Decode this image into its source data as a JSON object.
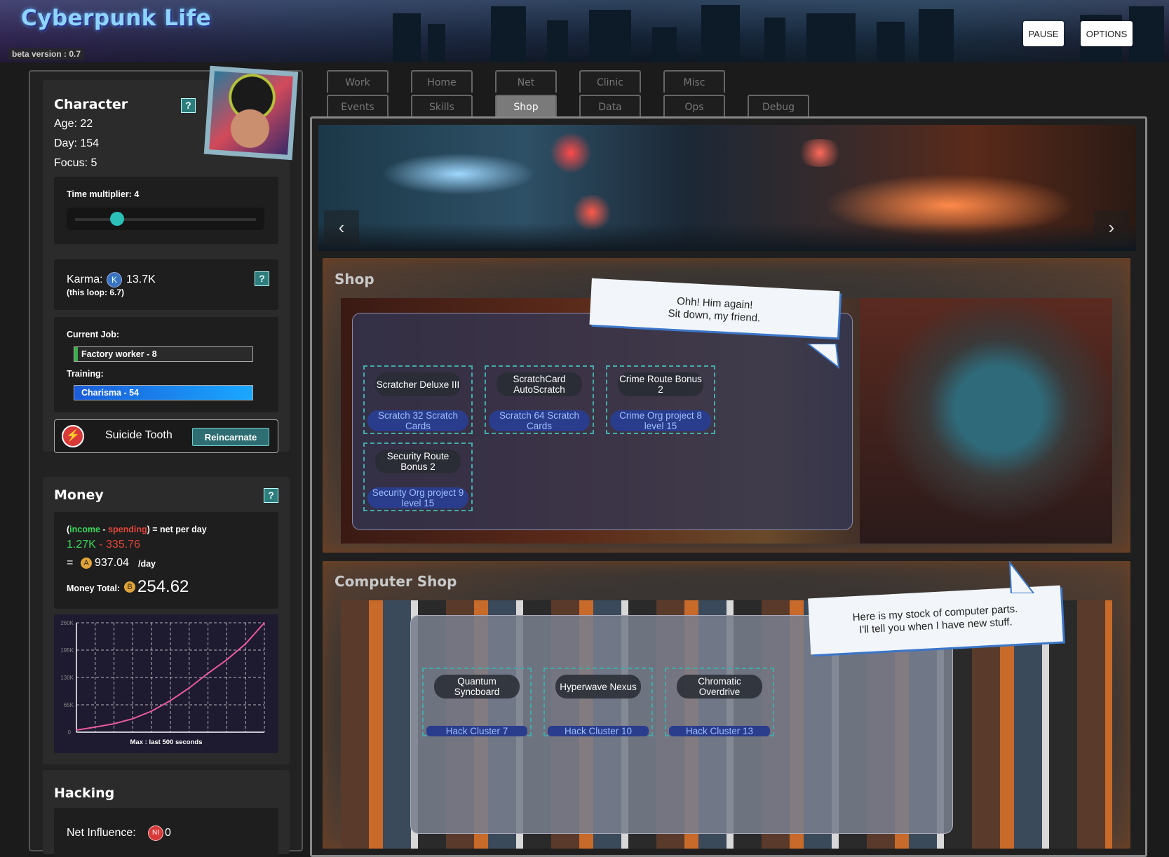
{
  "app": {
    "title": "Cyberpunk Life",
    "version": "beta version : 0.7",
    "pause_label": "PAUSE",
    "options_label": "OPTIONS"
  },
  "character": {
    "title": "Character",
    "help": "?",
    "age": "Age: 22",
    "day": "Day: 154",
    "focus": "Focus: 5",
    "time_multiplier_label": "Time multiplier: 4",
    "time_multiplier_value": 4,
    "karma_label": "Karma:",
    "karma_icon": "K",
    "karma_value": "13.7K",
    "karma_loop": "(this loop: 6.7)",
    "current_job_label": "Current Job:",
    "job": "Factory worker - 8",
    "job_progress": 0.02,
    "training_label": "Training:",
    "training": "Charisma - 54",
    "training_progress": 1.0,
    "suicide_label": "Suicide Tooth",
    "reincarnate_label": "Reincarnate"
  },
  "money": {
    "title": "Money",
    "help": "?",
    "formula_open": "(",
    "formula_income": "income",
    "formula_minus": " - ",
    "formula_spending": "spending",
    "formula_rest": ") = net per day",
    "income": "1.27K",
    "separator": " - ",
    "spending": "335.76",
    "equals": "=",
    "currency_icon": "A",
    "net": "937.04",
    "per_day": "/day",
    "total_label": "Money Total:",
    "total_icon": "B",
    "total": "254.62",
    "chart_note": "Max : last 500 seconds"
  },
  "hacking": {
    "title": "Hacking",
    "influence_label": "Net Influence:",
    "influence_icon": "NI",
    "influence_value": "0"
  },
  "tabs": {
    "row1": [
      "Work",
      "Home",
      "Net",
      "Clinic",
      "Misc"
    ],
    "row2": [
      "Events",
      "Skills",
      "Shop",
      "Data",
      "Ops",
      "Debug"
    ],
    "active": "Shop"
  },
  "banner": {
    "prev": "‹",
    "next": "›"
  },
  "shop": {
    "title": "Shop",
    "bubble_line1": "Ohh! Him again!",
    "bubble_line2": "Sit down, my friend.",
    "items": [
      {
        "name": "Scratcher Deluxe III",
        "price": "Scratch 32 Scratch Cards"
      },
      {
        "name": "ScratchCard AutoScratch",
        "price": "Scratch 64 Scratch Cards"
      },
      {
        "name": "Crime Route Bonus 2",
        "price": "Crime Org project 8 level 15"
      },
      {
        "name": "Security Route Bonus 2",
        "price": "Security Org project 9 level 15"
      }
    ]
  },
  "computer_shop": {
    "title": "Computer Shop",
    "bubble_line1": "Here is my stock of computer parts.",
    "bubble_line2": "I'll tell you when I have new stuff.",
    "items": [
      {
        "name": "Quantum Syncboard",
        "price": "Hack Cluster 7"
      },
      {
        "name": "Hyperwave Nexus",
        "price": "Hack Cluster 10"
      },
      {
        "name": "Chromatic Overdrive",
        "price": "Hack Cluster 13"
      }
    ]
  },
  "chart_data": {
    "type": "line",
    "title": "",
    "xlabel": "Max : last 500 seconds",
    "ylabel": "",
    "yticks": [
      "0",
      "65K",
      "130K",
      "195K",
      "260K"
    ],
    "ylim": [
      0,
      260000
    ],
    "x": [
      0,
      50,
      100,
      150,
      200,
      250,
      300,
      350,
      400,
      450,
      500
    ],
    "values": [
      5000,
      12000,
      20000,
      32000,
      50000,
      75000,
      105000,
      140000,
      172000,
      210000,
      260000
    ],
    "grid": true,
    "color": "#e85aa0"
  },
  "colors": {
    "accent": "#2e7d7d",
    "income": "#3ad65a",
    "spending": "#e0453a",
    "job_bar": "#3ab04a",
    "training_bar": "#1a7cff"
  }
}
